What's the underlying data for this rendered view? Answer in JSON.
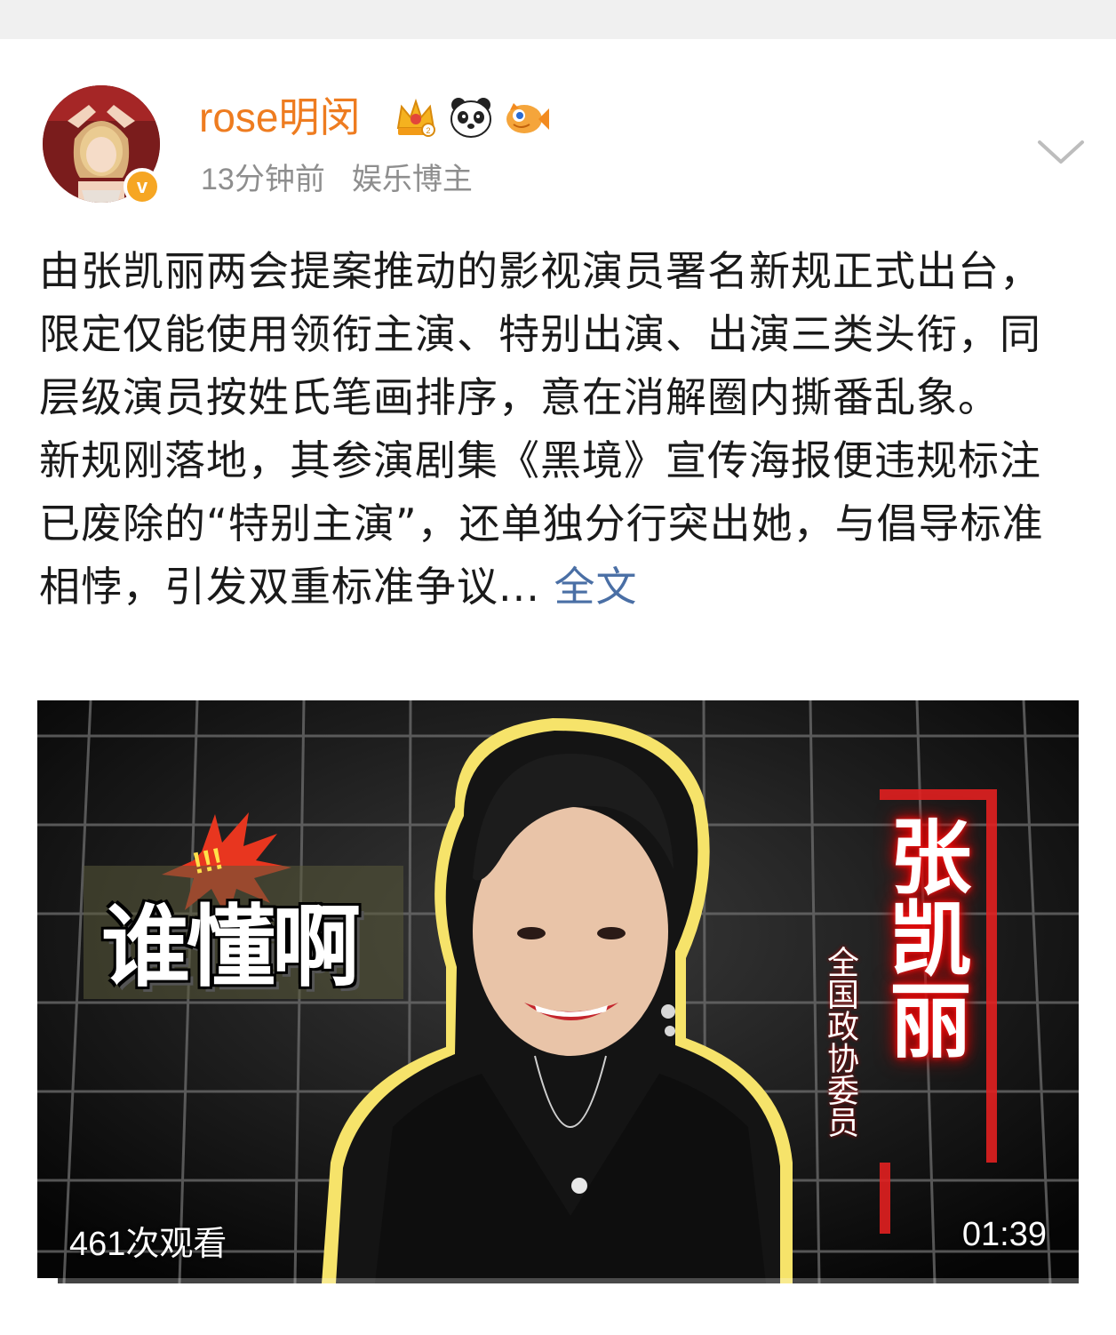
{
  "post": {
    "username": "rose明闵",
    "time_ago": "13分钟前",
    "author_tag": "娱乐博主",
    "badges": [
      "crown-badge-icon",
      "panda-badge-icon",
      "fish-badge-icon"
    ],
    "verified": true,
    "paragraphs": [
      "由张凯丽两会提案推动的影视演员署名新规正式出台，限定仅能使用领衔主演、特别出演、出演三类头衔，同层级演员按姓氏笔画排序，意在消解圈内撕番乱象。",
      "新规刚落地，其参演剧集《黑境》宣传海报便违规标注已废除的“特别主演”，还单独分行突出她，与倡导标准相悖，引发双重标准争议..."
    ],
    "full_text_link": "全文"
  },
  "video": {
    "sticker_text": "谁懂啊",
    "burst_text": "!!!",
    "person_name": "张凯丽",
    "person_title": "全国政协委员",
    "view_count": "461次观看",
    "duration": "01:39",
    "progress_fraction": 0.02
  },
  "colors": {
    "username": "#ee7c20",
    "link": "#4a6fa5",
    "meta": "#8e8e8e",
    "verified": "#f6a623"
  }
}
